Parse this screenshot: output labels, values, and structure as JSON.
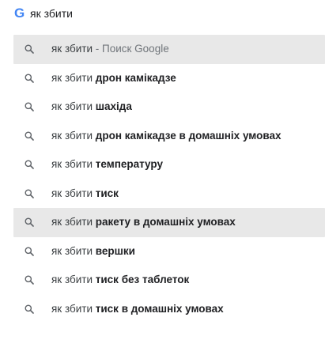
{
  "colors": {
    "logo": "#4285f4",
    "highlight": "#e8e8e8",
    "text": "#202124",
    "secondary": "#70757a"
  },
  "search": {
    "logo_letter": "G",
    "query": "як збити"
  },
  "suggestions": [
    {
      "prefix": "як збити",
      "suffix": " - Поиск Google",
      "bold": false,
      "highlighted": true,
      "icon": "search-icon"
    },
    {
      "prefix": "як збити ",
      "suffix": "дрон камікадзе",
      "bold": true,
      "highlighted": false,
      "icon": "search-icon"
    },
    {
      "prefix": "як збити ",
      "suffix": "шахіда",
      "bold": true,
      "highlighted": false,
      "icon": "search-icon"
    },
    {
      "prefix": "як збити ",
      "suffix": "дрон камікадзе в домашніх умовах",
      "bold": true,
      "highlighted": false,
      "icon": "search-icon"
    },
    {
      "prefix": "як збити ",
      "suffix": "температуру",
      "bold": true,
      "highlighted": false,
      "icon": "search-icon"
    },
    {
      "prefix": "як збити ",
      "suffix": "тиск",
      "bold": true,
      "highlighted": false,
      "icon": "search-icon"
    },
    {
      "prefix": "як збити ",
      "suffix": "ракету в домашніх умовах",
      "bold": true,
      "highlighted": true,
      "icon": "search-icon"
    },
    {
      "prefix": "як збити ",
      "suffix": "вершки",
      "bold": true,
      "highlighted": false,
      "icon": "search-icon"
    },
    {
      "prefix": "як збити ",
      "suffix": "тиск без таблеток",
      "bold": true,
      "highlighted": false,
      "icon": "search-icon"
    },
    {
      "prefix": "як збити ",
      "suffix": "тиск в домашніх умовах",
      "bold": true,
      "highlighted": false,
      "icon": "search-icon"
    }
  ]
}
